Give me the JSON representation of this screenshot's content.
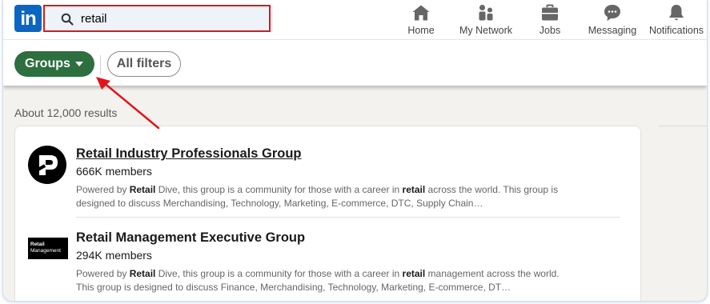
{
  "search": {
    "value": "retail"
  },
  "brand": {
    "logo_text": "in",
    "color": "#0a66c2"
  },
  "nav": {
    "items": [
      {
        "label": "Home",
        "icon": "home-icon"
      },
      {
        "label": "My Network",
        "icon": "people-icon"
      },
      {
        "label": "Jobs",
        "icon": "briefcase-icon"
      },
      {
        "label": "Messaging",
        "icon": "chat-icon"
      },
      {
        "label": "Notifications",
        "icon": "bell-icon"
      }
    ]
  },
  "filters": {
    "groups_label": "Groups",
    "groups_color": "#2d6f3e",
    "all_filters_label": "All filters"
  },
  "results": {
    "count_text": "About 12,000 results",
    "items": [
      {
        "title": "Retail Industry Professionals Group",
        "members": "666K members",
        "desc_pre": "Powered by ",
        "desc_bold1": "Retail",
        "desc_mid": " Dive, this group is a community for those with a career in ",
        "desc_bold2": "retail",
        "desc_post": " across the world. This group is designed to discuss Merchandising, Technology, Marketing, E-commerce, DTC, Supply Chain…"
      },
      {
        "title": "Retail Management Executive Group",
        "members": "294K members",
        "logo_text_1": "Retail",
        "logo_text_2": "Management",
        "desc_pre": "Powered by ",
        "desc_bold1": "Retail",
        "desc_mid": " Dive, this group is a community for those with a career in ",
        "desc_bold2": "retail",
        "desc_post": " management across the world. This group is designed to discuss Finance, Merchandising, Technology, Marketing, E-commerce, DT…"
      }
    ]
  },
  "annotation": {
    "highlight_color": "#e0151b"
  }
}
